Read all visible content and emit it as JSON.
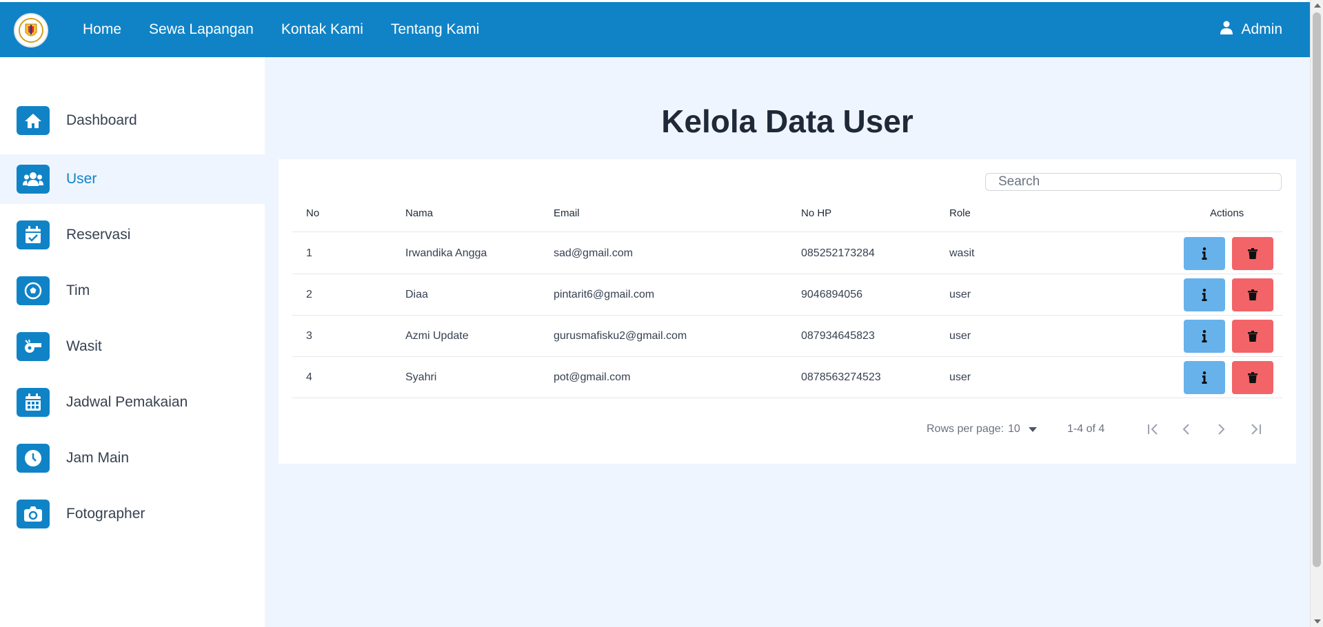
{
  "navbar": {
    "links": [
      "Home",
      "Sewa Lapangan",
      "Kontak Kami",
      "Tentang Kami"
    ],
    "user_label": "Admin"
  },
  "sidebar": {
    "items": [
      {
        "label": "Dashboard",
        "icon": "home-icon"
      },
      {
        "label": "User",
        "icon": "users-icon",
        "active": true
      },
      {
        "label": "Reservasi",
        "icon": "calendar-check-icon"
      },
      {
        "label": "Tim",
        "icon": "soccer-ball-icon"
      },
      {
        "label": "Wasit",
        "icon": "whistle-icon"
      },
      {
        "label": "Jadwal Pemakaian",
        "icon": "calendar-grid-icon"
      },
      {
        "label": "Jam Main",
        "icon": "clock-icon"
      },
      {
        "label": "Fotographer",
        "icon": "camera-icon"
      }
    ]
  },
  "main": {
    "title": "Kelola Data User",
    "search_placeholder": "Search",
    "columns": {
      "no": "No",
      "nama": "Nama",
      "email": "Email",
      "no_hp": "No HP",
      "role": "Role",
      "actions": "Actions"
    },
    "rows": [
      {
        "no": "1",
        "nama": "Irwandika Angga",
        "email": "sad@gmail.com",
        "no_hp": "085252173284",
        "role": "wasit"
      },
      {
        "no": "2",
        "nama": "Diaa",
        "email": "pintarit6@gmail.com",
        "no_hp": "9046894056",
        "role": "user"
      },
      {
        "no": "3",
        "nama": "Azmi Update",
        "email": "gurusmafisku2@gmail.com",
        "no_hp": "087934645823",
        "role": "user"
      },
      {
        "no": "4",
        "nama": "Syahri",
        "email": "pot@gmail.com",
        "no_hp": "0878563274523",
        "role": "user"
      }
    ],
    "pagination": {
      "rows_per_page_label": "Rows per page:",
      "rows_per_page_value": "10",
      "range": "1-4 of 4"
    }
  },
  "colors": {
    "primary": "#1083c7",
    "info_button": "#67b2eb",
    "delete_button": "#f26468",
    "main_bg": "#eff5ff"
  }
}
